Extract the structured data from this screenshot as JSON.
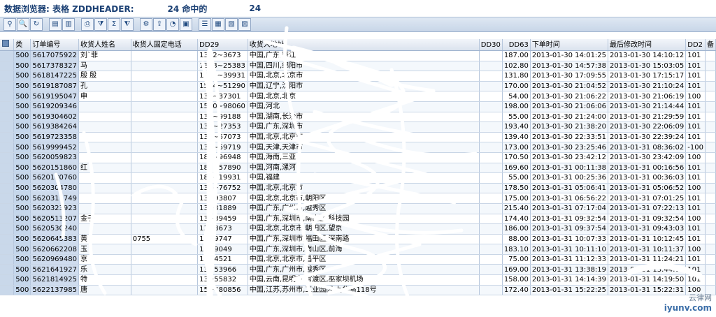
{
  "title": {
    "label": "数据浏览器: 表格 ZDDHEADER:",
    "hits_value": "24 命中的",
    "hits_shown": "24"
  },
  "toolbar": {
    "buttons": [
      {
        "icon": "details-icon",
        "glyph": "⚲"
      },
      {
        "icon": "magnify-icon",
        "glyph": "🔍"
      },
      {
        "icon": "refresh-icon",
        "glyph": "↻"
      },
      {
        "icon": "first-page-icon",
        "glyph": "▤"
      },
      {
        "icon": "prev-page-icon",
        "glyph": "▥"
      },
      {
        "icon": "print-icon",
        "glyph": "⎙"
      },
      {
        "icon": "filter-icon",
        "glyph": "⧩"
      },
      {
        "icon": "sum-icon",
        "glyph": "Σ"
      },
      {
        "icon": "subtotal-icon",
        "glyph": "⧨"
      },
      {
        "icon": "change-layout-icon",
        "glyph": "⚙"
      },
      {
        "icon": "export-icon",
        "glyph": "⇪"
      },
      {
        "icon": "graphic-icon",
        "glyph": "◔"
      },
      {
        "icon": "abc-icon",
        "glyph": "▣"
      },
      {
        "icon": "columns-icon",
        "glyph": "☰"
      },
      {
        "icon": "table-icon",
        "glyph": "▦"
      },
      {
        "icon": "grid-icon",
        "glyph": "▧"
      },
      {
        "icon": "layout-icon",
        "glyph": "▨"
      }
    ]
  },
  "columns": [
    "类",
    "订单编号",
    "收货人姓名",
    "收货人固定电话",
    "DD29",
    "收货人地址",
    "DD30",
    "DD63",
    "下单时间",
    "最后修改时间",
    "DD2",
    "备"
  ],
  "rows": [
    {
      "lei": "500",
      "order": "5617075922",
      "name": "刘`菲",
      "phone": "",
      "dd29": "1372~3673",
      "addr": "中国,广东,蓬江",
      "dd30": "",
      "dd63": "187.00",
      "t1": "2013-01-30 14:01:25",
      "t2": "2013-01-30 14:10:12",
      "dd2": "101"
    },
    {
      "lei": "500",
      "order": "5617378327",
      "name": "马",
      "phone": "",
      "dd29": "1398~25383",
      "addr": "中国,四川,绵阳市",
      "dd30": "",
      "dd63": "102.80",
      "t1": "2013-01-30 14:57:38",
      "t2": "2013-01-30 15:03:05",
      "dd2": "101"
    },
    {
      "lei": "500",
      "order": "5618147225",
      "name": "殷 殷",
      "phone": "",
      "dd29": "1861~39931",
      "addr": "中国,北京,北京市",
      "dd30": "",
      "dd63": "131.80",
      "t1": "2013-01-30 17:09:55",
      "t2": "2013-01-30 17:15:17",
      "dd2": "101"
    },
    {
      "lei": "500",
      "order": "5619187087",
      "name": "孔",
      "phone": "",
      "dd29": "1584~51290",
      "addr": "中国,辽宁,沈阳市",
      "dd30": "",
      "dd63": "170.00",
      "t1": "2013-01-30 21:04:52",
      "t2": "2013-01-30 21:10:24",
      "dd2": "101"
    },
    {
      "lei": "500",
      "order": "5619195047",
      "name": "申",
      "phone": "",
      "dd29": "139~37301",
      "addr": "中国,北京,北京",
      "dd30": "",
      "dd63": "54.00",
      "t1": "2013-01-30 21:06:22",
      "t2": "2013-01-30 21:06:19",
      "dd2": "100"
    },
    {
      "lei": "500",
      "order": "5619209346",
      "name": "",
      "phone": "",
      "dd29": "1520~98060",
      "addr": "中国,河北",
      "dd30": "",
      "dd63": "198.00",
      "t1": "2013-01-30 21:06:06",
      "t2": "2013-01-30 21:14:44",
      "dd2": "101"
    },
    {
      "lei": "500",
      "order": "5619304602",
      "name": "",
      "phone": "",
      "dd29": "137~99188",
      "addr": "中国,湖南,长沙市",
      "dd30": "",
      "dd63": "55.00",
      "t1": "2013-01-30 21:24:00",
      "t2": "2013-01-30 21:29:59",
      "dd2": "101"
    },
    {
      "lei": "500",
      "order": "5619384264",
      "name": "",
      "phone": "",
      "dd29": "136~27353",
      "addr": "中国,广东,深圳市",
      "dd30": "",
      "dd63": "193.40",
      "t1": "2013-01-30 21:38:20",
      "t2": "2013-01-30 22:06:09",
      "dd2": "101"
    },
    {
      "lei": "500",
      "order": "5619723358",
      "name": "",
      "phone": "",
      "dd29": "135~57073",
      "addr": "中国,北京,北京市",
      "dd30": "",
      "dd63": "139.40",
      "t1": "2013-01-30 22:33:51",
      "t2": "2013-01-30 22:39:24",
      "dd2": "101"
    },
    {
      "lei": "500",
      "order": "5619999452",
      "name": "",
      "phone": "",
      "dd29": "139~59719",
      "addr": "中国,天津,天津市",
      "dd30": "",
      "dd63": "173.00",
      "t1": "2013-01-30 23:25:46",
      "t2": "2013-01-31 08:36:02",
      "dd2": "-100"
    },
    {
      "lei": "500",
      "order": "5620059823",
      "name": "",
      "phone": "",
      "dd29": "183~96948",
      "addr": "中国,海南,三亚",
      "dd30": "",
      "dd63": "170.50",
      "t1": "2013-01-30 23:42:12",
      "t2": "2013-01-30 23:42:09",
      "dd2": "100"
    },
    {
      "lei": "500",
      "order": "5620151860",
      "name": "红",
      "phone": "",
      "dd29": "187~57890",
      "addr": "中国,河南,漯河",
      "dd30": "",
      "dd63": "169.60",
      "t1": "2013-01-31 00:11:38",
      "t2": "2013-01-31 00:16:56",
      "dd2": "101"
    },
    {
      "lei": "500",
      "order": "5620180760",
      "name": "",
      "phone": "",
      "dd29": "189~19931",
      "addr": "中国,福建",
      "dd30": "",
      "dd63": "55.00",
      "t1": "2013-01-31 00:25:36",
      "t2": "2013-01-31 00:36:03",
      "dd2": "101"
    },
    {
      "lei": "500",
      "order": "5620304780",
      "name": "",
      "phone": "",
      "dd29": "136~76752",
      "addr": "中国,北京,北京市",
      "dd30": "",
      "dd63": "178.50",
      "t1": "2013-01-31 05:06:41",
      "t2": "2013-01-31 05:06:52",
      "dd2": "100"
    },
    {
      "lei": "500",
      "order": "5620317749",
      "name": "",
      "phone": "",
      "dd29": "13~93807",
      "addr": "中国,北京,北京市,朝阳区",
      "dd30": "",
      "dd63": "175.00",
      "t1": "2013-01-31 06:56:22",
      "t2": "2013-01-31 07:01:25",
      "dd2": "101"
    },
    {
      "lei": "500",
      "order": "5620323923",
      "name": "",
      "phone": "",
      "dd29": "13~31889",
      "addr": "中国,广东,广州市,越秀区",
      "dd30": "",
      "dd63": "215.40",
      "t1": "2013-01-31 07:17:04",
      "t2": "2013-01-31 07:22:13",
      "dd2": "101"
    },
    {
      "lei": "500",
      "order": "5620513207",
      "name": "金子",
      "phone": "",
      "dd29": "13~39459",
      "addr": "中国,广东,深圳市,南山区,科技园",
      "dd30": "",
      "dd63": "174.40",
      "t1": "2013-01-31 09:32:54",
      "t2": "2013-01-31 09:32:54",
      "dd2": "100"
    },
    {
      "lei": "500",
      "order": "5620530240",
      "name": "",
      "phone": "",
      "dd29": "13~8673",
      "addr": "中国,北京,北京市,朝阳区,望京",
      "dd30": "",
      "dd63": "186.00",
      "t1": "2013-01-31 09:37:54",
      "t2": "2013-01-31 09:43:03",
      "dd2": "101"
    },
    {
      "lei": "500",
      "order": "5620645383",
      "name": "黄",
      "phone": "0755",
      "dd29": "13~9747",
      "addr": "中国,广东,深圳市,福田区,深南路",
      "dd30": "",
      "dd63": "88.00",
      "t1": "2013-01-31 10:07:33",
      "t2": "2013-01-31 10:12:45",
      "dd2": "101"
    },
    {
      "lei": "500",
      "order": "5620662208",
      "name": "玉",
      "phone": "",
      "dd29": "18~9049",
      "addr": "中国,广东,深圳市,南山区,前海",
      "dd30": "",
      "dd63": "183.10",
      "t1": "2013-01-31 10:11:10",
      "t2": "2013-01-31 10:11:37",
      "dd2": "100"
    },
    {
      "lei": "500",
      "order": "5620969480",
      "name": "京",
      "phone": "",
      "dd29": "13~4521",
      "addr": "中国,北京,北京市,昌平区",
      "dd30": "",
      "dd63": "75.00",
      "t1": "2013-01-31 11:12:33",
      "t2": "2013-01-31 11:24:21",
      "dd2": "101"
    },
    {
      "lei": "500",
      "order": "5621641927",
      "name": "乐",
      "phone": "",
      "dd29": "13~53966",
      "addr": "中国,广东,广州市,越秀区",
      "dd30": "",
      "dd63": "169.00",
      "t1": "2013-01-31 13:38:19",
      "t2": "2013-01-31 13:44:05",
      "dd2": "101"
    },
    {
      "lei": "500",
      "order": "5621814925",
      "name": "特",
      "phone": "",
      "dd29": "13~55832",
      "addr": "中国,云南,昆明市,官渡区,巫家坝机场",
      "dd30": "",
      "dd63": "158.00",
      "t1": "2013-01-31 14:14:39",
      "t2": "2013-01-31 14:19:50",
      "dd2": "101"
    },
    {
      "lei": "500",
      "order": "5622137985",
      "name": "唐",
      "phone": "",
      "dd29": "15~480856",
      "addr": "中国,江苏,苏州市,工业园区,九华路118号",
      "dd30": "",
      "dd63": "172.40",
      "t1": "2013-01-31 15:22:25",
      "t2": "2013-01-31 15:22:31",
      "dd2": "100"
    }
  ],
  "watermark": {
    "logo": "云律网",
    "url": "iyunv.com"
  },
  "colors": {
    "title": "#1a3f73",
    "toolbar": "#c8d6e8",
    "header": "#dbe3ee",
    "key_column": "#c5d7ec"
  }
}
